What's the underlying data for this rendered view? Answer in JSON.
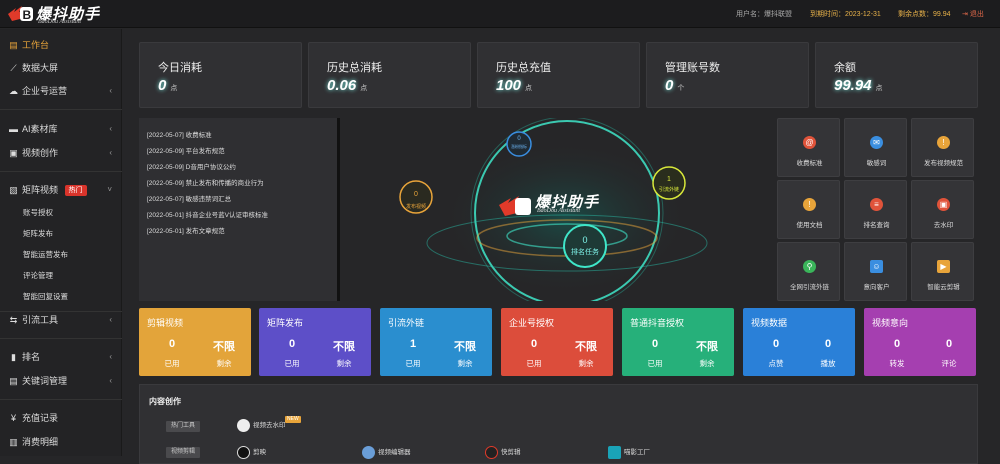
{
  "header": {
    "logo_title": "爆抖助手",
    "logo_sub": "BaoDou Assistant",
    "logo_mark": "B",
    "username_label": "用户名：",
    "username": "爆抖联盟",
    "expire_label": "到期时间：",
    "expire": "2023-12-31",
    "points_label": "剩余点数：",
    "points": "99.94",
    "logout_icon": "logout-icon",
    "logout_label": "退出"
  },
  "sidebar": {
    "items": [
      {
        "label": "工作台",
        "icon": "▤"
      },
      {
        "label": "数据大屏",
        "icon": "📈"
      },
      {
        "label": "企业号运营",
        "icon": "☁"
      },
      {
        "label": "AI素材库",
        "icon": "▦"
      },
      {
        "label": "视频创作",
        "icon": "▣"
      },
      {
        "label": "矩阵视频",
        "icon": "▧",
        "badge": "热门"
      },
      {
        "label": "引流工具",
        "icon": "⇆"
      },
      {
        "label": "排名",
        "icon": "▮"
      },
      {
        "label": "关键词管理",
        "icon": "▤"
      },
      {
        "label": "充值记录",
        "icon": "¥"
      },
      {
        "label": "消费明细",
        "icon": "▥"
      }
    ],
    "subitems": [
      "账号授权",
      "矩阵发布",
      "智能运营发布",
      "评论管理",
      "智能回复设置"
    ]
  },
  "stats": [
    {
      "label": "今日消耗",
      "value": "0",
      "unit": "点"
    },
    {
      "label": "历史总消耗",
      "value": "0.06",
      "unit": "点"
    },
    {
      "label": "历史总充值",
      "value": "100",
      "unit": "点"
    },
    {
      "label": "管理账号数",
      "value": "0",
      "unit": "个"
    },
    {
      "label": "余额",
      "value": "99.94",
      "unit": "点"
    }
  ],
  "notices": [
    "[2022-05-07] 收费标准",
    "[2022-05-09] 平台发布规范",
    "[2022-05-09] D音用户协议公约",
    "[2022-05-09] 禁止发布和传播的商业行为",
    "[2022-05-07] 敏感违禁词汇总",
    "[2022-05-01] 抖音企业号蓝V认证审核标准",
    "[2022-05-01] 发布文章规范"
  ],
  "center": {
    "logo_title": "爆抖助手",
    "logo_sub": "BaoDou Assistant",
    "orbs": [
      {
        "num": "0",
        "label": "发布视频"
      },
      {
        "num": "0",
        "label": "涨粉指标"
      },
      {
        "num": "1",
        "label": "引流外链"
      },
      {
        "num": "0",
        "label": "排名任务"
      }
    ]
  },
  "tools": [
    {
      "label": "收费标准",
      "icon": "@",
      "color": "#e0533a"
    },
    {
      "label": "敏感词",
      "icon": "✉",
      "color": "#3a8ee0"
    },
    {
      "label": "发布视频规范",
      "icon": "!",
      "color": "#e8a43a"
    },
    {
      "label": "使用文档",
      "icon": "!",
      "color": "#e8a43a"
    },
    {
      "label": "排名查询",
      "icon": "≡",
      "color": "#e0533a"
    },
    {
      "label": "去水印",
      "icon": "▣",
      "color": "#e0533a"
    },
    {
      "label": "全网引流外链",
      "icon": "⚲",
      "color": "#3ab55a"
    },
    {
      "label": "意向客户",
      "icon": "☺",
      "color": "#3a8ee0"
    },
    {
      "label": "智能云剪辑",
      "icon": "▶",
      "color": "#e8a43a"
    }
  ],
  "cards": [
    {
      "title": "剪辑视频",
      "v1": "0",
      "l1": "已用",
      "v2": "不限",
      "l2": "剩余",
      "color": "#e3a43a"
    },
    {
      "title": "矩阵发布",
      "v1": "0",
      "l1": "已用",
      "v2": "不限",
      "l2": "剩余",
      "color": "#5d4fc8"
    },
    {
      "title": "引流外链",
      "v1": "1",
      "l1": "已用",
      "v2": "不限",
      "l2": "剩余",
      "color": "#2a8ecf"
    },
    {
      "title": "企业号授权",
      "v1": "0",
      "l1": "已用",
      "v2": "不限",
      "l2": "剩余",
      "color": "#dc4d3b"
    },
    {
      "title": "普通抖音授权",
      "v1": "0",
      "l1": "已用",
      "v2": "不限",
      "l2": "剩余",
      "color": "#26b07a"
    },
    {
      "title": "视频数据",
      "v1": "0",
      "l1": "点赞",
      "v2": "0",
      "l2": "播放",
      "color": "#2a80d8"
    },
    {
      "title": "视频意向",
      "v1": "0",
      "l1": "转发",
      "v2": "0",
      "l2": "评论",
      "color": "#a53fb0"
    }
  ],
  "content": {
    "title": "内容创作",
    "tag_hot": "热门工具",
    "tag_edit": "视频剪辑",
    "hot_item": "视频去水印",
    "new_badge": "NEW",
    "edit_items": [
      "剪映",
      "视频编辑器",
      "快剪辑",
      "喵影工厂"
    ]
  }
}
